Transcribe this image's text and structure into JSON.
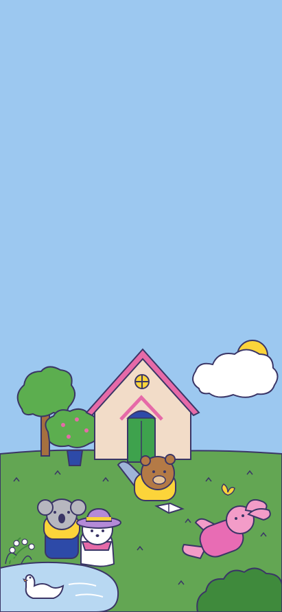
{
  "scene": {
    "description_free": true,
    "colors": {
      "sky": "#9cc8f0",
      "grass": "#63a653",
      "grass_dark": "#3f8a3c",
      "house_wall": "#f2dcc8",
      "roof": "#e66aa8",
      "door": "#3ea24d",
      "sun": "#fcd43a",
      "pond": "#b8d8f2",
      "outline": "#3a3566"
    },
    "elements": [
      {
        "id": "sky",
        "icon": "sky"
      },
      {
        "id": "sun",
        "icon": "sun-icon"
      },
      {
        "id": "cloud",
        "icon": "cloud-icon"
      },
      {
        "id": "house",
        "icon": "house-icon"
      },
      {
        "id": "tree",
        "icon": "tree-icon"
      },
      {
        "id": "potted-plant",
        "icon": "plant-icon"
      },
      {
        "id": "bear-reading",
        "icon": "bear-icon"
      },
      {
        "id": "book",
        "icon": "book-icon"
      },
      {
        "id": "koala",
        "icon": "koala-icon"
      },
      {
        "id": "puppy-with-hat",
        "icon": "dog-icon"
      },
      {
        "id": "pink-bunny",
        "icon": "rabbit-icon"
      },
      {
        "id": "butterfly",
        "icon": "butterfly-icon"
      },
      {
        "id": "duck",
        "icon": "duck-icon"
      },
      {
        "id": "pond",
        "icon": "pond-icon"
      },
      {
        "id": "lily-of-the-valley",
        "icon": "flower-icon"
      },
      {
        "id": "bush",
        "icon": "bush-icon"
      }
    ]
  }
}
